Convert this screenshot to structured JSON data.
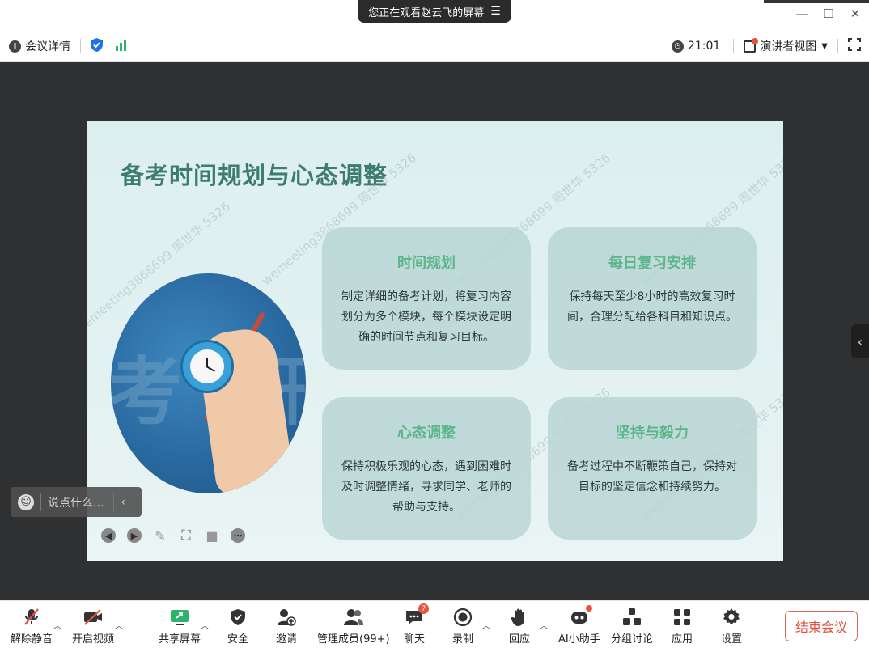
{
  "share_banner": {
    "text": "您正在观看赵云飞的屏幕",
    "menu_icon": "☰"
  },
  "window_controls": {
    "minimize": "—",
    "maximize": "☐",
    "close": "✕"
  },
  "infobar": {
    "meeting_details": "会议详情",
    "time": "21:01",
    "view_mode": "演讲者视图"
  },
  "slide": {
    "title": "备考时间规划与心态调整",
    "photo_text_left": "考",
    "photo_text_right": "研",
    "watermarks": [
      "wemeeting3868699 周世华 5326",
      "wemeeting3868699 周世华 5326",
      "wemeeting3868699 周世华 5326",
      "wemeeting3868699 周世华 5326",
      "wemeeting3868699 周世华 5326",
      "wemeeting3868699 周世华 5326"
    ],
    "cards": [
      {
        "title": "时间规划",
        "body": "制定详细的备考计划，将复习内容划分为多个模块，每个模块设定明确的时间节点和复习目标。"
      },
      {
        "title": "每日复习安排",
        "body": "保持每天至少8小时的高效复习时间，合理分配给各科目和知识点。"
      },
      {
        "title": "心态调整",
        "body": "保持积极乐观的心态，遇到困难时及时调整情绪，寻求同学、老师的帮助与支持。"
      },
      {
        "title": "坚持与毅力",
        "body": "备考过程中不断鞭策自己，保持对目标的坚定信念和持续努力。"
      }
    ]
  },
  "chatbox": {
    "placeholder": "说点什么..."
  },
  "toolbar": {
    "mute": "解除静音",
    "video": "开启视频",
    "share": "共享屏幕",
    "security": "安全",
    "invite": "邀请",
    "members": "管理成员(99+)",
    "chat": "聊天",
    "chat_badge": "7",
    "record": "录制",
    "react": "回应",
    "ai": "AI小助手",
    "breakout": "分组讨论",
    "apps": "应用",
    "settings": "设置",
    "end": "结束会议"
  },
  "colors": {
    "title_green": "#3e7c6f",
    "card_title_green": "#5db58b",
    "end_red": "#e0503e",
    "badge_red": "#e8533e"
  }
}
